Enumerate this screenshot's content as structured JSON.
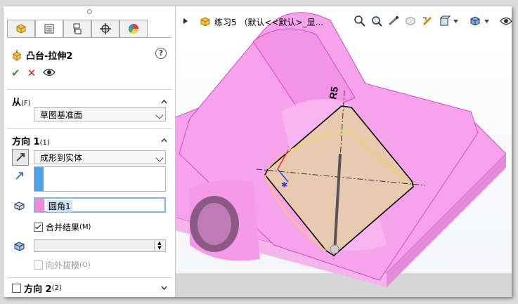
{
  "feature": {
    "title": "凸台-拉伸2",
    "help": "?"
  },
  "tabs": [
    {
      "name": "feature-manager-tab"
    },
    {
      "name": "property-manager-tab"
    },
    {
      "name": "configuration-manager-tab"
    },
    {
      "name": "dimxpert-manager-tab"
    },
    {
      "name": "display-manager-tab"
    }
  ],
  "from": {
    "header": "从",
    "header_small": "(F)",
    "value": "草图基准面"
  },
  "dir1": {
    "header": "方向 1",
    "header_small": "(1)",
    "end_condition": "成形到实体",
    "face": "圆角1",
    "merge_label": "合并结果",
    "merge_small": "(M)",
    "merge_checked": true,
    "draft_label": "向外拔模",
    "draft_small": "(O)",
    "draft_checked": false
  },
  "dir2": {
    "header": "方向 2",
    "header_small": "(2)",
    "checked": false
  },
  "viewport": {
    "part_name": "练习5 （默认<<默认>_显...",
    "dimension_label": "R5"
  },
  "colors": {
    "accent_blue": "#4aa3f0",
    "face_pink": "#f08ad8",
    "model_pink": "#f7a3ec",
    "sketch_face": "#e6cca8"
  }
}
